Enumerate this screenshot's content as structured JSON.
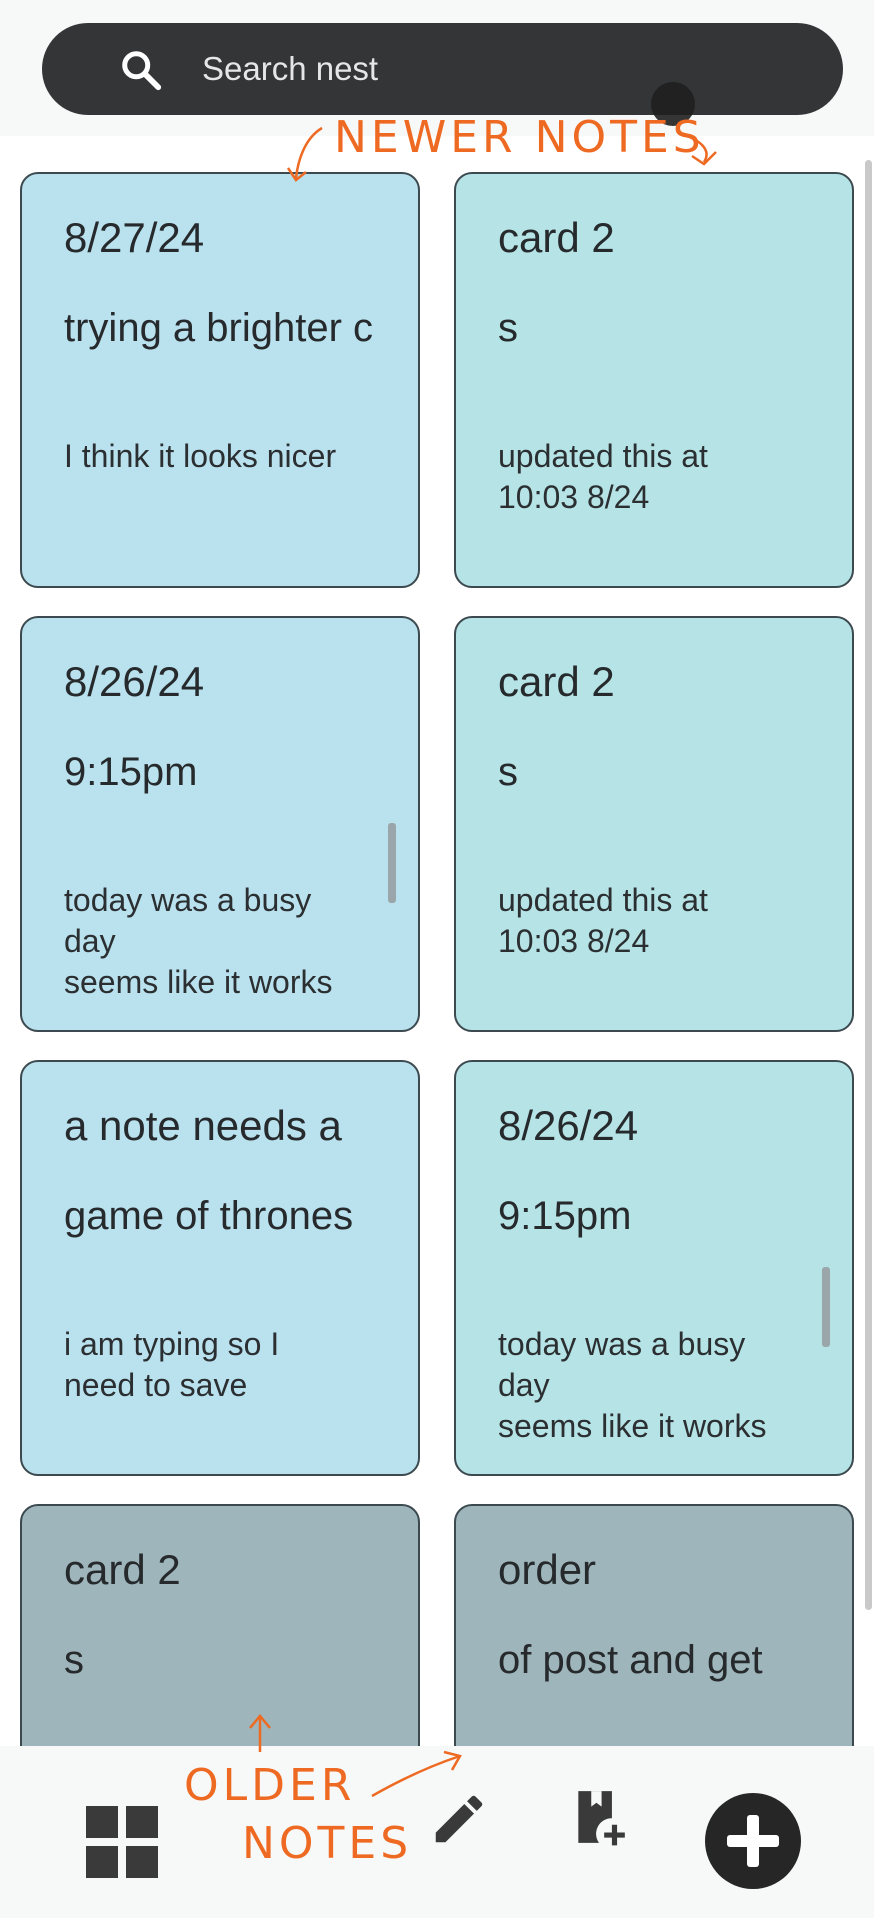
{
  "search": {
    "placeholder": "Search nest",
    "icon": "search-icon"
  },
  "notes": [
    {
      "title": "8/27/24",
      "subtitle": "trying a brighter c",
      "body": "I think it looks nicer",
      "color": "#b9e1ee"
    },
    {
      "title": "card 2",
      "subtitle": "s",
      "body": "updated this at\n10:03 8/24",
      "color": "#b5e3e6"
    },
    {
      "title": "8/26/24",
      "subtitle": "9:15pm",
      "body": "today was a busy\nday\nseems like it works\nwith all notes",
      "color": "#b9e1ee"
    },
    {
      "title": "card 2",
      "subtitle": "s",
      "body": "updated this at\n10:03 8/24",
      "color": "#b5e3e6"
    },
    {
      "title": "a note needs a",
      "subtitle": "game of thrones",
      "body": "i am typing so I\nneed to save",
      "color": "#b9e1ee"
    },
    {
      "title": "8/26/24",
      "subtitle": "9:15pm",
      "body": "today was a busy\nday\nseems like it works\nwith all notes",
      "color": "#b5e3e6"
    },
    {
      "title": "card 2",
      "subtitle": "s",
      "body": "",
      "color": "#9eb6bb"
    },
    {
      "title": "order",
      "subtitle": "of post and get",
      "body": "",
      "color": "#9eb6bb"
    }
  ],
  "annotations": {
    "newer": "NEWER NOTES",
    "older_line1": "OLDER",
    "older_line2": "NOTES",
    "color": "#ee6a22"
  },
  "bottom_nav": {
    "items": [
      "grid-view-icon",
      "edit-pencil-icon",
      "bookmark-add-icon",
      "add-note-icon"
    ]
  }
}
